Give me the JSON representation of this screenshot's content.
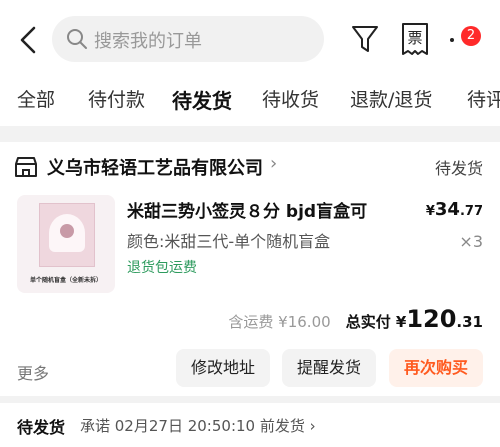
{
  "header": {
    "search_placeholder": "搜索我的订单",
    "receipt_label": "票",
    "message_badge": "2"
  },
  "tabs": [
    {
      "label": "全部"
    },
    {
      "label": "待付款"
    },
    {
      "label": "待发货"
    },
    {
      "label": "待收货"
    },
    {
      "label": "退款/退货"
    },
    {
      "label": "待评"
    }
  ],
  "order": {
    "shop_name": "义乌市轻语工艺品有限公司",
    "shop_chevron": "›",
    "status": "待发货",
    "product": {
      "title": "米甜三势小签灵８分 bjd盲盒可",
      "spec": "颜色:米甜三代-单个随机盲盒",
      "tag": "退货包运费",
      "thumb_caption": "单个随机盲盒（全新未拆）",
      "price_symbol": "¥",
      "price_int": "34",
      "price_dec": ".77",
      "quantity": "×3"
    },
    "shipping": "含运费 ¥16.00",
    "paid_label": "总实付",
    "paid_symbol": "¥",
    "paid_int": "120",
    "paid_dec": ".31",
    "more_label": "更多",
    "buttons": {
      "modify_address": "修改地址",
      "remind_ship": "提醒发货",
      "buy_again": "再次购买"
    }
  },
  "next_order": {
    "status": "待发货",
    "promise": "承诺 02月27日 20:50:10 前发货 ›"
  },
  "colors": {
    "accent": "#ff5a1f",
    "badge": "#ff2a2a",
    "green_tag": "#2e9b5e"
  }
}
